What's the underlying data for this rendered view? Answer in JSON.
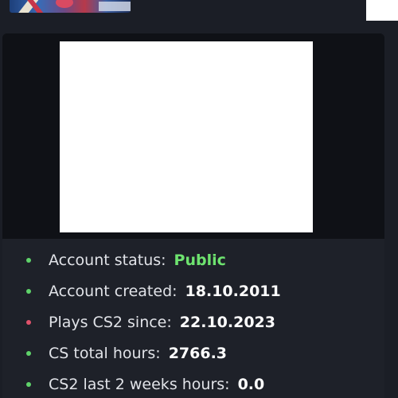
{
  "colors": {
    "page_background": "#1b1e26",
    "card_background": "#14161d",
    "info_background": "#1e2129",
    "dot_green": "#5fd36a",
    "dot_red": "#e0526b",
    "public_green": "#6ee36f",
    "text": "#e6e8ec"
  },
  "header": {
    "thumbnail_icon": "game-thumbnail-image"
  },
  "media": {
    "placeholder_icon": "blank-image-placeholder"
  },
  "info": {
    "items": [
      {
        "label": "Account status:",
        "value": "Public",
        "status": "ok"
      },
      {
        "label": "Account created:",
        "value": "18.10.2011",
        "status": "ok"
      },
      {
        "label": "Plays CS2 since:",
        "value": "22.10.2023",
        "status": "warning"
      },
      {
        "label": "CS total hours:",
        "value": "2766.3",
        "status": "ok"
      },
      {
        "label": "CS2 last 2 weeks hours:",
        "value": "0.0",
        "status": "ok"
      }
    ]
  }
}
